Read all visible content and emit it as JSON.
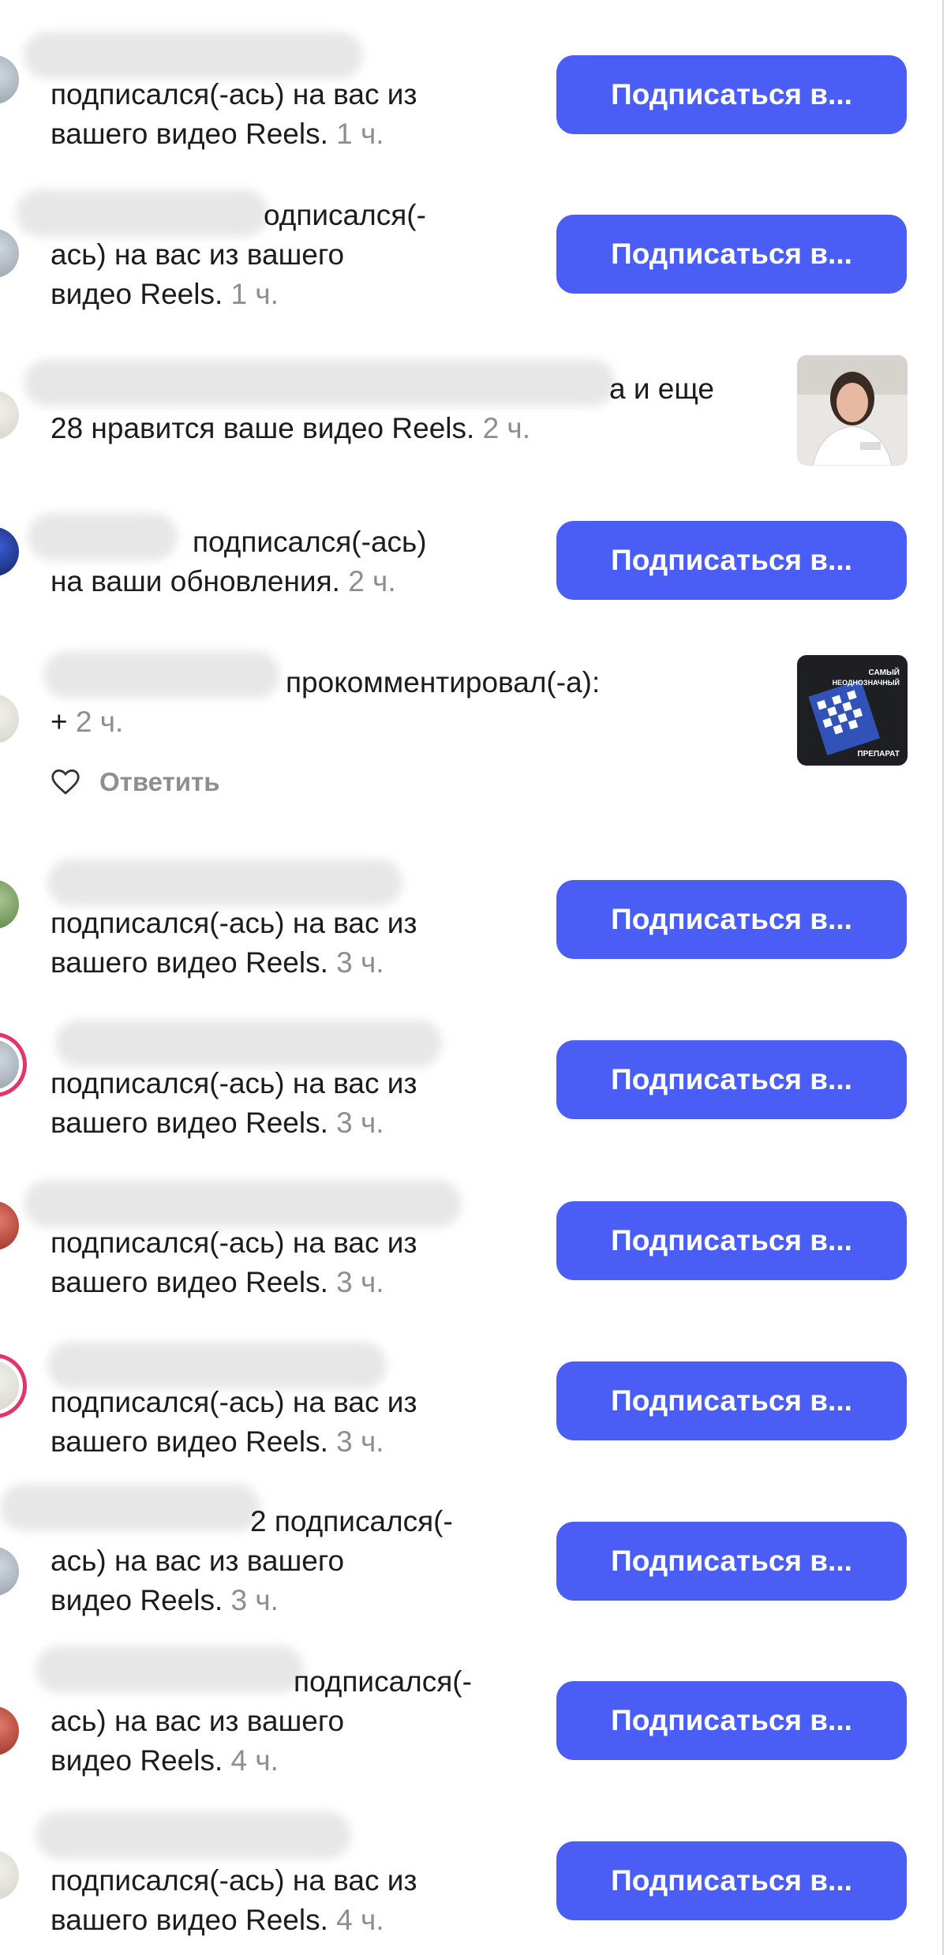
{
  "button_label": "Подписаться в...",
  "rows": [
    {
      "line1": "подписался(-ась) на вас из",
      "line2": "вашего видео Reels.",
      "time": "1 ч."
    },
    {
      "line1": "одписался(-",
      "line2": "ась) на вас из вашего",
      "line3": "видео Reels.",
      "time": "1 ч."
    },
    {
      "line1": "а и еще",
      "line2": "28 нравится ваше видео Reels.",
      "time": "2 ч."
    },
    {
      "line1": "подписался(-ась)",
      "line2": "на ваши обновления.",
      "time": "2 ч."
    },
    {
      "line1": "прокомментировал(-а):",
      "line2": "+",
      "time": "2 ч.",
      "reply": "Ответить"
    },
    {
      "line1": "подписался(-ась) на вас из",
      "line2": "вашего видео Reels.",
      "time": "3 ч."
    },
    {
      "line1": "подписался(-ась) на вас из",
      "line2": "вашего видео Reels.",
      "time": "3 ч."
    },
    {
      "line1": "подписался(-ась) на вас из",
      "line2": "вашего видео Reels.",
      "time": "3 ч."
    },
    {
      "line1": "подписался(-ась) на вас из",
      "line2": "вашего видео Reels.",
      "time": "3 ч."
    },
    {
      "line1": "2 подписался(-",
      "line2": "ась) на вас из вашего",
      "line3": "видео Reels.",
      "time": "3 ч."
    },
    {
      "line1": "подписался(-",
      "line2": "ась) на вас из вашего",
      "line3": "видео Reels.",
      "time": "4 ч."
    },
    {
      "line1": "подписался(-ась) на вас из",
      "line2": "вашего видео Reels.",
      "time": "4 ч."
    }
  ],
  "thumb2_text": {
    "top": "САМЫЙ",
    "mid": "НЕОДНОЗНАЧНЫЙ",
    "bottom": "ПРЕПАРАТ"
  },
  "colors": {
    "button": "#4a5df5",
    "time": "#8e8e8e",
    "ring": "#e3356b"
  },
  "icons": {
    "reply_like": "heart-outline-icon"
  }
}
